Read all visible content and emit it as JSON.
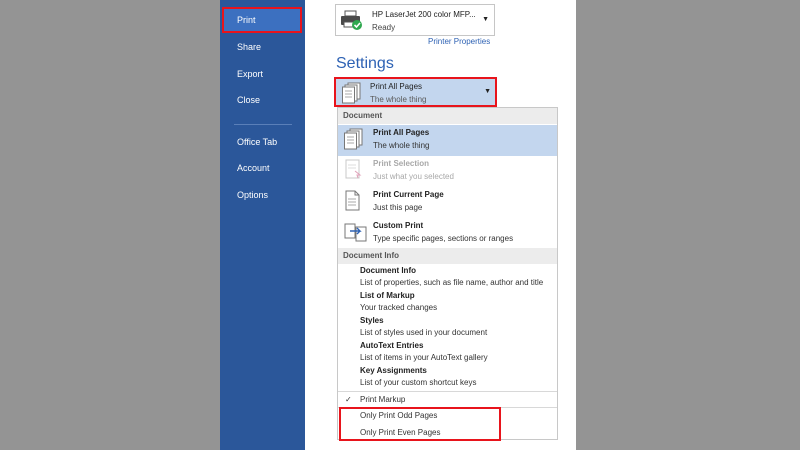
{
  "nav": {
    "items": [
      "Print",
      "Share",
      "Export",
      "Close",
      "Office Tab",
      "Account",
      "Options"
    ]
  },
  "printer": {
    "name": "HP LaserJet 200 color MFP...",
    "status": "Ready",
    "properties_link": "Printer Properties"
  },
  "settings": {
    "title": "Settings",
    "selected_label": "Print All Pages",
    "selected_sub": "The whole thing"
  },
  "dropdown": {
    "sections": [
      "Document",
      "Document Info"
    ],
    "document_items": [
      {
        "label": "Print All Pages",
        "sub": "The whole thing",
        "icon": "pages-icon"
      },
      {
        "label": "Print Selection",
        "sub": "Just what you selected",
        "icon": "selection-icon"
      },
      {
        "label": "Print Current Page",
        "sub": "Just this page",
        "icon": "page-icon"
      },
      {
        "label": "Custom Print",
        "sub": "Type specific pages, sections or ranges",
        "icon": "custom-print-icon"
      }
    ],
    "info_items": [
      {
        "label": "Document Info",
        "sub": "List of properties, such as file name, author and title"
      },
      {
        "label": "List of Markup",
        "sub": "Your tracked changes"
      },
      {
        "label": "Styles",
        "sub": "List of styles used in your document"
      },
      {
        "label": "AutoText Entries",
        "sub": "List of items in your AutoText gallery"
      },
      {
        "label": "Key Assignments",
        "sub": "List of your custom shortcut keys"
      }
    ],
    "options": [
      "Print Markup",
      "Only Print Odd Pages",
      "Only Print Even Pages"
    ],
    "check_mark": "✓"
  },
  "colors": {
    "nav_bg": "#2b579a",
    "highlight": "#e8141c",
    "selected_bg": "#c3d6ee",
    "accent": "#2e62b4"
  }
}
